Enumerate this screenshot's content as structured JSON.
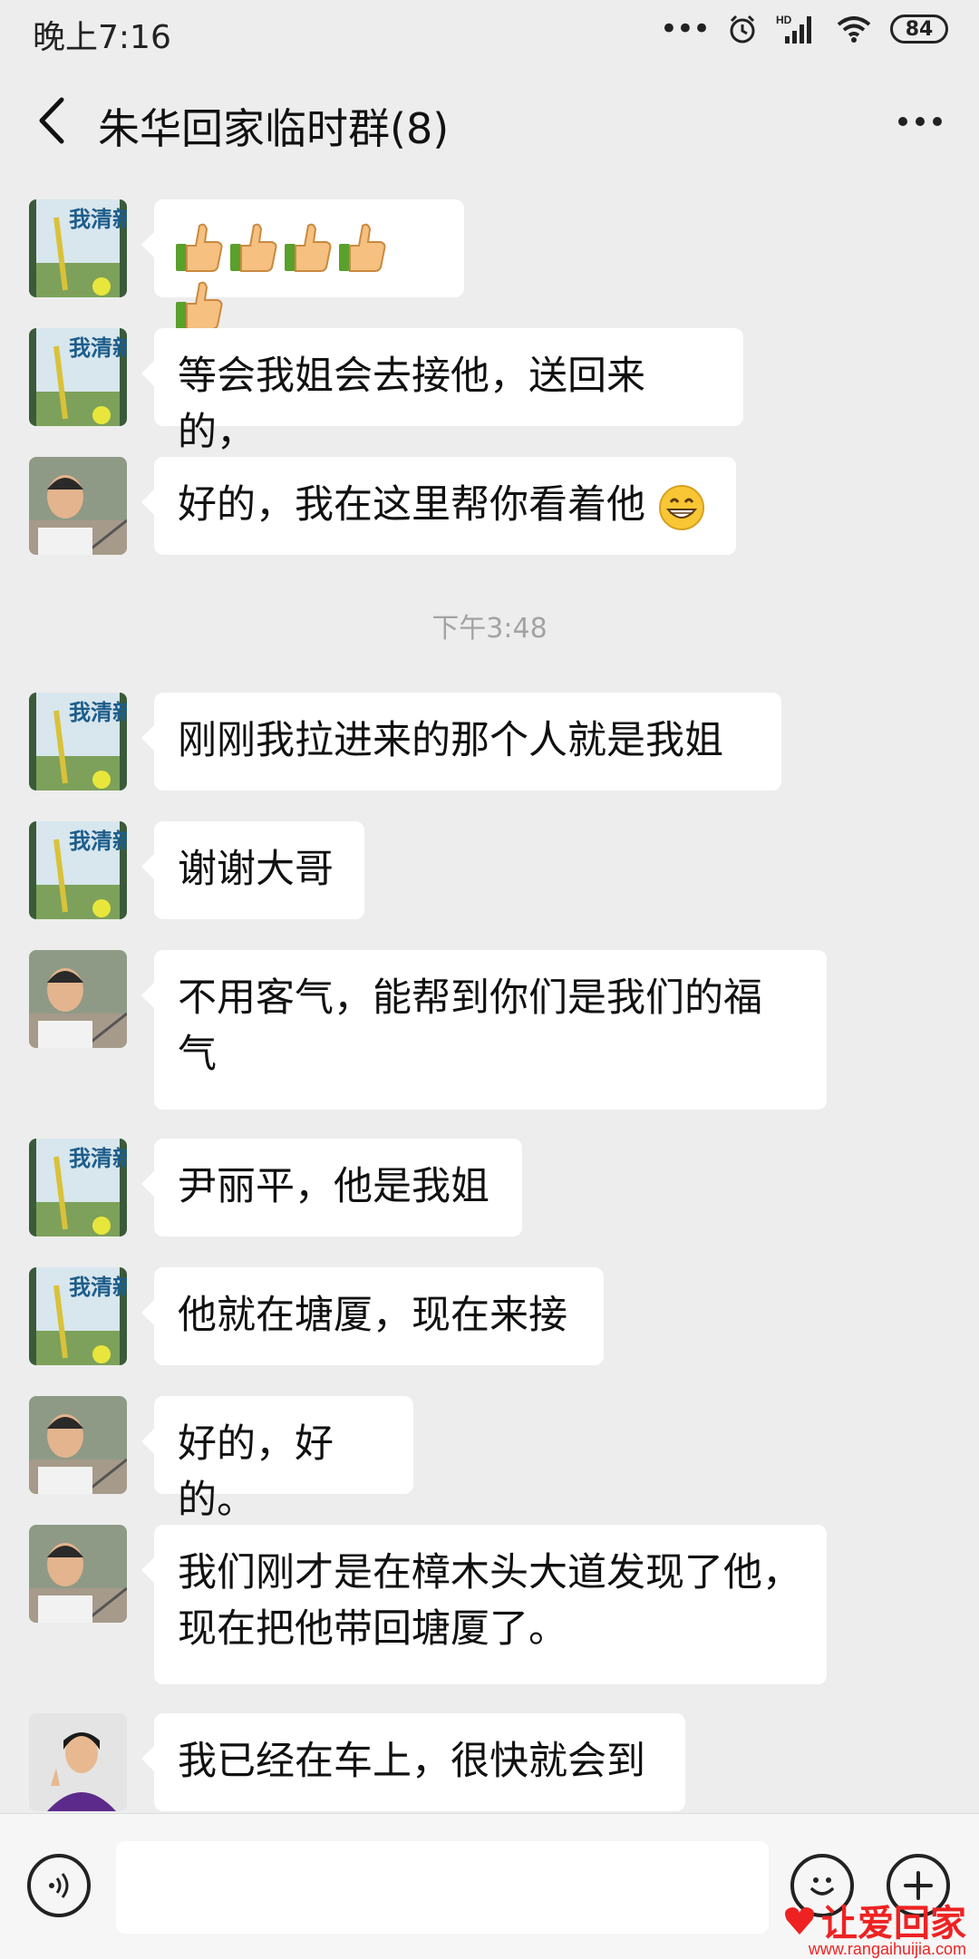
{
  "status_bar": {
    "time": "晚上7:16",
    "battery": "84",
    "hd_label": "HD"
  },
  "header": {
    "title": "朱华回家临时群(8)"
  },
  "messages": [
    {
      "kind": "thumbs",
      "count": 5
    },
    {
      "text": "等会我姐会去接他，送回来的，"
    },
    {
      "text": "好的，我在这里帮你看着他"
    },
    {
      "text": "刚刚我拉进来的那个人就是我姐"
    },
    {
      "text": "谢谢大哥"
    },
    {
      "line1": "不用客气，能帮到你们是我们的福",
      "line2": "气"
    },
    {
      "text": "尹丽平，他是我姐"
    },
    {
      "text": "他就在塘厦，现在来接"
    },
    {
      "text": "好的，好的。"
    },
    {
      "line1": "我们刚才是在樟木头大道发现了他，",
      "line2": "现在把他带回塘厦了。"
    },
    {
      "text": "我已经在车上，很快就会到"
    }
  ],
  "timestamp": "下午3:48",
  "avatar_text": "我清新",
  "watermark": {
    "text": "让爱回家",
    "url": "www.rangaihuijia.com"
  },
  "colors": {
    "background": "#ededed",
    "bubble": "#ffffff",
    "watermark": "#e22222"
  }
}
